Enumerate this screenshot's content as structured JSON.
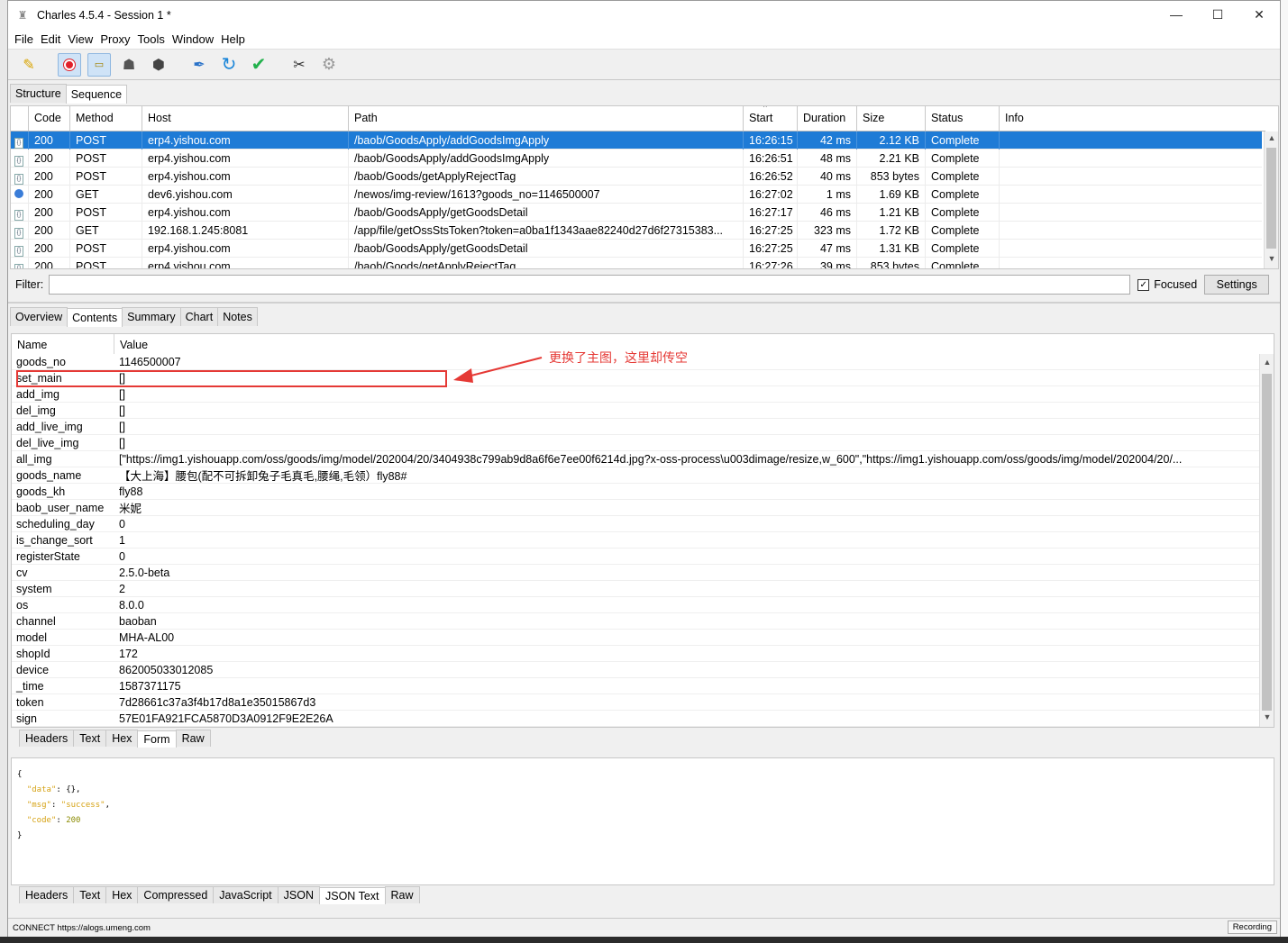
{
  "window": {
    "title": "Charles 4.5.4 - Session 1 *",
    "minimize": "—",
    "maximize": "☐",
    "close": "✕"
  },
  "menu": [
    "File",
    "Edit",
    "View",
    "Proxy",
    "Tools",
    "Window",
    "Help"
  ],
  "top_tabs": [
    "Structure",
    "Sequence"
  ],
  "columns": {
    "code": "Code",
    "method": "Method",
    "host": "Host",
    "path": "Path",
    "start": "Start",
    "duration": "Duration",
    "size": "Size",
    "status": "Status",
    "info": "Info"
  },
  "requests": [
    {
      "code": "200",
      "method": "POST",
      "host": "erp4.yishou.com",
      "path": "/baob/GoodsApply/addGoodsImgApply",
      "start": "16:26:15",
      "duration": "42 ms",
      "size": "2.12 KB",
      "status": "Complete"
    },
    {
      "code": "200",
      "method": "POST",
      "host": "erp4.yishou.com",
      "path": "/baob/GoodsApply/addGoodsImgApply",
      "start": "16:26:51",
      "duration": "48 ms",
      "size": "2.21 KB",
      "status": "Complete"
    },
    {
      "code": "200",
      "method": "POST",
      "host": "erp4.yishou.com",
      "path": "/baob/Goods/getApplyRejectTag",
      "start": "16:26:52",
      "duration": "40 ms",
      "size": "853 bytes",
      "status": "Complete"
    },
    {
      "code": "200",
      "method": "GET",
      "host": "dev6.yishou.com",
      "path": "/newos/img-review/1613?goods_no=1146500007",
      "start": "16:27:02",
      "duration": "1 ms",
      "size": "1.69 KB",
      "status": "Complete"
    },
    {
      "code": "200",
      "method": "POST",
      "host": "erp4.yishou.com",
      "path": "/baob/GoodsApply/getGoodsDetail",
      "start": "16:27:17",
      "duration": "46 ms",
      "size": "1.21 KB",
      "status": "Complete"
    },
    {
      "code": "200",
      "method": "GET",
      "host": "192.168.1.245:8081",
      "path": "/app/file/getOssStsToken?token=a0ba1f1343aae82240d27d6f27315383...",
      "start": "16:27:25",
      "duration": "323 ms",
      "size": "1.72 KB",
      "status": "Complete"
    },
    {
      "code": "200",
      "method": "POST",
      "host": "erp4.yishou.com",
      "path": "/baob/GoodsApply/getGoodsDetail",
      "start": "16:27:25",
      "duration": "47 ms",
      "size": "1.31 KB",
      "status": "Complete"
    },
    {
      "code": "200",
      "method": "POST",
      "host": "erp4.yishou.com",
      "path": "/baob/Goods/getApplyRejectTag",
      "start": "16:27:26",
      "duration": "39 ms",
      "size": "853 bytes",
      "status": "Complete"
    }
  ],
  "filter": {
    "label": "Filter:",
    "value": "",
    "focused_label": "Focused",
    "settings_label": "Settings"
  },
  "detail_tabs": [
    "Overview",
    "Contents",
    "Summary",
    "Chart",
    "Notes"
  ],
  "form": {
    "name_header": "Name",
    "value_header": "Value",
    "rows": [
      {
        "name": "goods_no",
        "value": "1146500007"
      },
      {
        "name": "set_main",
        "value": "[]"
      },
      {
        "name": "add_img",
        "value": "[]"
      },
      {
        "name": "del_img",
        "value": "[]"
      },
      {
        "name": "add_live_img",
        "value": "[]"
      },
      {
        "name": "del_live_img",
        "value": "[]"
      },
      {
        "name": "all_img",
        "value": "[\"https://img1.yishouapp.com/oss/goods/img/model/202004/20/3404938c799ab9d8a6f6e7ee00f6214d.jpg?x-oss-process\\u003dimage/resize,w_600\",\"https://img1.yishouapp.com/oss/goods/img/model/202004/20/..."
      },
      {
        "name": "goods_name",
        "value": "【大上海】腰包(配不可拆卸兔子毛真毛,腰绳,毛领）fly88#"
      },
      {
        "name": "goods_kh",
        "value": "fly88"
      },
      {
        "name": "baob_user_name",
        "value": "米妮"
      },
      {
        "name": "scheduling_day",
        "value": "0"
      },
      {
        "name": "is_change_sort",
        "value": "1"
      },
      {
        "name": "registerState",
        "value": "0"
      },
      {
        "name": "cv",
        "value": "2.5.0-beta"
      },
      {
        "name": "system",
        "value": "2"
      },
      {
        "name": "os",
        "value": "8.0.0"
      },
      {
        "name": "channel",
        "value": "baoban"
      },
      {
        "name": "model",
        "value": "MHA-AL00"
      },
      {
        "name": "shopId",
        "value": "172"
      },
      {
        "name": "device",
        "value": "862005033012085"
      },
      {
        "name": "_time",
        "value": "1587371175"
      },
      {
        "name": "token",
        "value": "7d28661c37a3f4b17d8a1e35015867d3"
      },
      {
        "name": "sign",
        "value": "57E01FA921FCA5870D3A0912F9E2E26A"
      }
    ]
  },
  "annotation": {
    "text": "更换了主图，这里却传空",
    "color": "#e53935"
  },
  "request_tabs": [
    "Headers",
    "Text",
    "Hex",
    "Form",
    "Raw"
  ],
  "json": {
    "open": "{",
    "k1": "\"data\"",
    "v1": "{},",
    "k2": "\"msg\"",
    "v2": "\"success\"",
    "comma2": ",",
    "k3": "\"code\"",
    "v3": "200",
    "close": "}"
  },
  "response_tabs": [
    "Headers",
    "Text",
    "Hex",
    "Compressed",
    "JavaScript",
    "JSON",
    "JSON Text",
    "Raw"
  ],
  "status": {
    "left": "CONNECT https://alogs.umeng.com",
    "recording": "Recording"
  },
  "colors": {
    "selection": "#1e7bd6",
    "accent_red": "#e53935"
  }
}
